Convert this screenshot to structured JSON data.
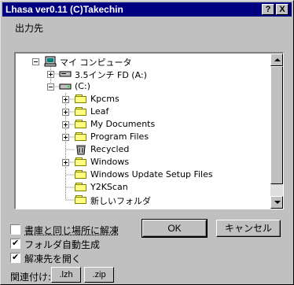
{
  "window": {
    "title": "Lhasa ver0.11 (C)Takechin",
    "help_label": "?",
    "close_label": "X"
  },
  "dialog": {
    "heading": "出力先"
  },
  "tree": {
    "items": [
      {
        "label": "マイ コンピュータ",
        "icon": "my-computer-icon",
        "expander": "minus"
      },
      {
        "label": "3.5インチ FD (A:)",
        "icon": "floppy-drive-icon",
        "expander": "plus"
      },
      {
        "label": "(C:)",
        "icon": "hard-drive-icon",
        "expander": "minus"
      },
      {
        "label": "Kpcms",
        "icon": "folder-icon",
        "expander": "plus"
      },
      {
        "label": "Leaf",
        "icon": "folder-icon",
        "expander": "plus"
      },
      {
        "label": "My Documents",
        "icon": "folder-icon",
        "expander": "plus"
      },
      {
        "label": "Program Files",
        "icon": "folder-icon",
        "expander": "plus"
      },
      {
        "label": "Recycled",
        "icon": "recycle-bin-icon",
        "expander": "none"
      },
      {
        "label": "Windows",
        "icon": "folder-icon",
        "expander": "plus"
      },
      {
        "label": "Windows Update Setup Files",
        "icon": "folder-icon",
        "expander": "none"
      },
      {
        "label": "Y2KScan",
        "icon": "folder-icon",
        "expander": "none"
      },
      {
        "label": "新しいフォルダ",
        "icon": "folder-icon",
        "expander": "none"
      }
    ]
  },
  "options": {
    "extract_to_same_location": {
      "label": "書庫と同じ場所に解凍",
      "checked": false
    },
    "auto_create_folder": {
      "label": "フォルダ自動生成",
      "checked": true
    },
    "open_destination": {
      "label": "解凍先を開く",
      "checked": true
    }
  },
  "buttons": {
    "ok": "OK",
    "cancel": "キャンセル"
  },
  "association": {
    "label": "関連付け:",
    "lzh": ".lzh",
    "zip": ".zip"
  },
  "colors": {
    "titlebar": "#000080",
    "face": "#c0c0c0",
    "folder": "#ffff80"
  }
}
